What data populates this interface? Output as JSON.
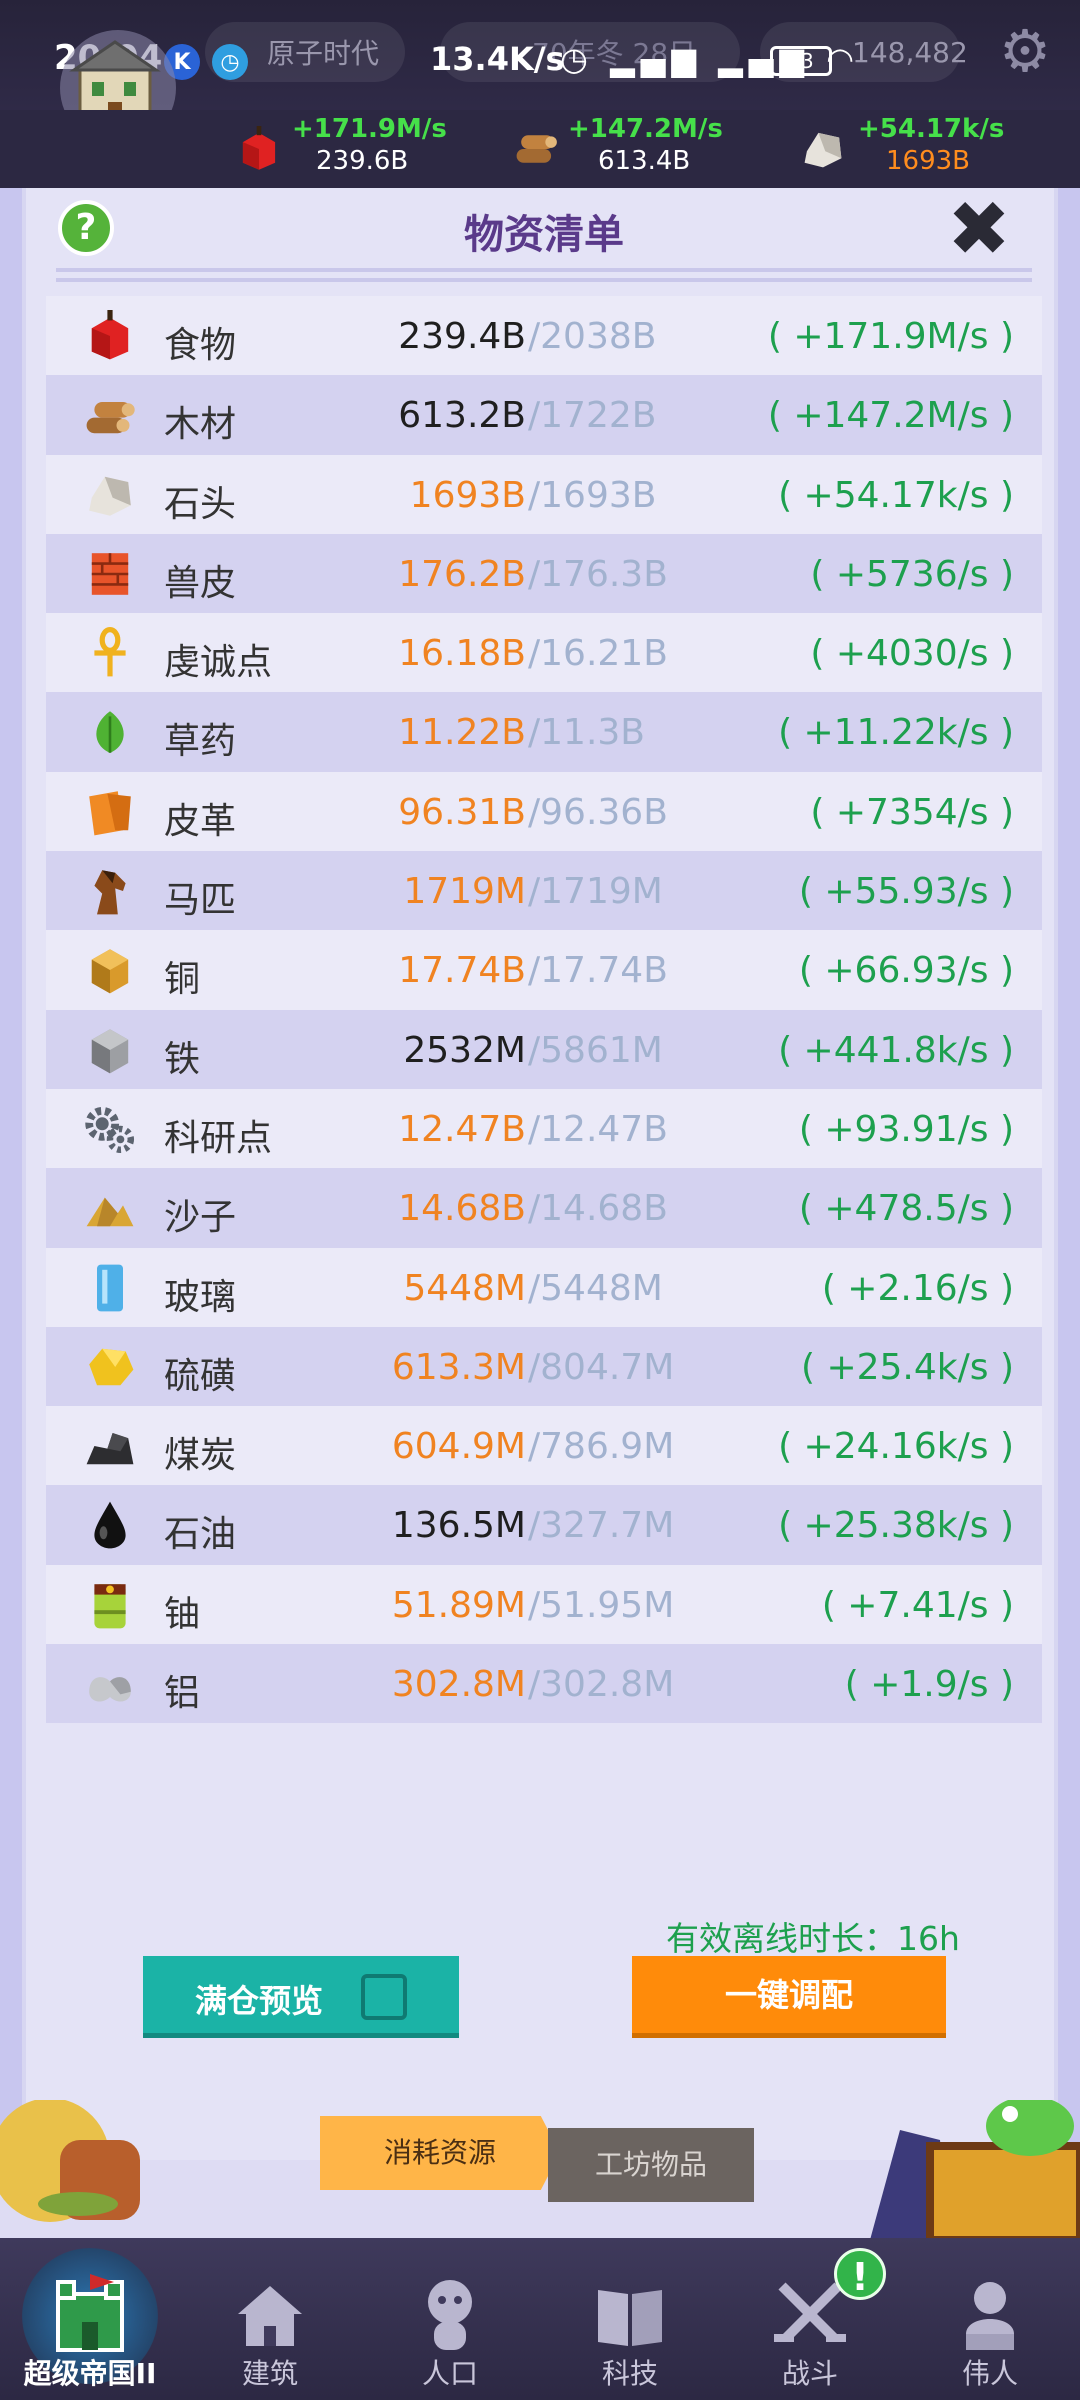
{
  "status_bar": {
    "time": "20:04",
    "network_speed": "13.4K/s",
    "battery": "23"
  },
  "game_header": {
    "era_label": "原子时代",
    "season_label": "70年冬 28日",
    "coins": "148,482",
    "top_resources": [
      {
        "name": "food",
        "rate": "+171.9M/s",
        "total": "239.6B",
        "total_color": "white"
      },
      {
        "name": "wood",
        "rate": "+147.2M/s",
        "total": "613.4B",
        "total_color": "white"
      },
      {
        "name": "stone",
        "rate": "+54.17k/s",
        "total": "1693B",
        "total_color": "orange"
      }
    ]
  },
  "panel": {
    "title": "物资清单",
    "help_label": "?",
    "resources": [
      {
        "icon": "apple-icon",
        "name": "食物",
        "amount": "239.4B",
        "cap": "/2038B",
        "rate": "( +171.9M/s )",
        "full": false
      },
      {
        "icon": "wood-logs-icon",
        "name": "木材",
        "amount": "613.2B",
        "cap": "/1722B",
        "rate": "( +147.2M/s )",
        "full": false
      },
      {
        "icon": "stone-icon",
        "name": "石头",
        "amount": "1693B",
        "cap": "/1693B",
        "rate": "( +54.17k/s )",
        "full": true
      },
      {
        "icon": "brick-hide-icon",
        "name": "兽皮",
        "amount": "176.2B",
        "cap": "/176.3B",
        "rate": "( +5736/s )",
        "full": true
      },
      {
        "icon": "ankh-icon",
        "name": "虔诚点",
        "amount": "16.18B",
        "cap": "/16.21B",
        "rate": "( +4030/s )",
        "full": true
      },
      {
        "icon": "leaf-icon",
        "name": "草药",
        "amount": "11.22B",
        "cap": "/11.3B",
        "rate": "( +11.22k/s )",
        "full": true
      },
      {
        "icon": "leather-icon",
        "name": "皮革",
        "amount": "96.31B",
        "cap": "/96.36B",
        "rate": "( +7354/s )",
        "full": true
      },
      {
        "icon": "horse-icon",
        "name": "马匹",
        "amount": "1719M",
        "cap": "/1719M",
        "rate": "( +55.93/s )",
        "full": true
      },
      {
        "icon": "copper-cube-icon",
        "name": "铜",
        "amount": "17.74B",
        "cap": "/17.74B",
        "rate": "( +66.93/s )",
        "full": true
      },
      {
        "icon": "iron-cube-icon",
        "name": "铁",
        "amount": "2532M",
        "cap": "/5861M",
        "rate": "( +441.8k/s )",
        "full": false
      },
      {
        "icon": "gears-icon",
        "name": "科研点",
        "amount": "12.47B",
        "cap": "/12.47B",
        "rate": "( +93.91/s )",
        "full": true
      },
      {
        "icon": "sand-pile-icon",
        "name": "沙子",
        "amount": "14.68B",
        "cap": "/14.68B",
        "rate": "( +478.5/s )",
        "full": true
      },
      {
        "icon": "glass-pane-icon",
        "name": "玻璃",
        "amount": "5448M",
        "cap": "/5448M",
        "rate": "( +2.16/s )",
        "full": true
      },
      {
        "icon": "sulfur-icon",
        "name": "硫磺",
        "amount": "613.3M",
        "cap": "/804.7M",
        "rate": "( +25.4k/s )",
        "full": true
      },
      {
        "icon": "coal-icon",
        "name": "煤炭",
        "amount": "604.9M",
        "cap": "/786.9M",
        "rate": "( +24.16k/s )",
        "full": true
      },
      {
        "icon": "oil-drop-icon",
        "name": "石油",
        "amount": "136.5M",
        "cap": "/327.7M",
        "rate": "( +25.38k/s )",
        "full": false
      },
      {
        "icon": "uranium-barrel-icon",
        "name": "铀",
        "amount": "51.89M",
        "cap": "/51.95M",
        "rate": "( +7.41/s )",
        "full": true
      },
      {
        "icon": "aluminum-ingot-icon",
        "name": "铝",
        "amount": "302.8M",
        "cap": "/302.8M",
        "rate": "( +1.9/s )",
        "full": true
      }
    ],
    "offline_time": "有效离线时长：16h",
    "btn_preview": "满仓预览",
    "btn_oneclick": "一键调配",
    "tab_consume": "消耗资源",
    "tab_workshop": "工坊物品"
  },
  "nav": {
    "items": [
      {
        "label": "超级帝国II",
        "icon": "castle-icon"
      },
      {
        "label": "建筑",
        "icon": "house-icon"
      },
      {
        "label": "人口",
        "icon": "person-icon"
      },
      {
        "label": "科技",
        "icon": "book-icon"
      },
      {
        "label": "战斗",
        "icon": "swords-icon"
      },
      {
        "label": "伟人",
        "icon": "bust-icon"
      }
    ],
    "alert": "!"
  },
  "colors": {
    "accent_green": "#1da04e",
    "accent_orange": "#f08321",
    "button_teal": "#1bb3a6",
    "button_orange": "#ff8b0a"
  }
}
